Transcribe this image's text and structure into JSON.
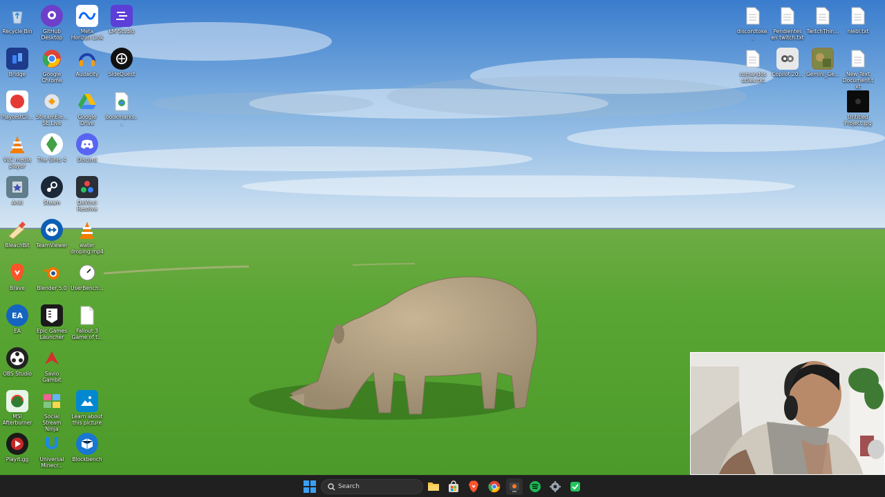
{
  "desktop": {
    "left_icons": [
      {
        "label": "Recycle Bin",
        "icon": "recycle-bin-icon",
        "color": "#c8d8e8"
      },
      {
        "label": "GitHub Desktop",
        "icon": "github-desktop-icon",
        "color": "#6e40c9"
      },
      {
        "label": "Meta Horizon Link",
        "icon": "meta-horizon-link-icon",
        "color": "#0a66ff"
      },
      {
        "label": "LM Studio",
        "icon": "lm-studio-icon",
        "color": "#5b3fd6"
      },
      {
        "label": "Bridge",
        "icon": "bridge-icon",
        "color": "#1e3a8a"
      },
      {
        "label": "Google Chrome",
        "icon": "chrome-icon",
        "color": "#34a853"
      },
      {
        "label": "Audacity",
        "icon": "audacity-icon",
        "color": "#1e40af"
      },
      {
        "label": "SideQuest",
        "icon": "sidequest-icon",
        "color": "#111111"
      },
      {
        "label": "PlaytestCli...",
        "icon": "playtestcloud-icon",
        "color": "#e53935"
      },
      {
        "label": "StreamEle... SE.Live",
        "icon": "streamelements-icon",
        "color": "#dfe6ee"
      },
      {
        "label": "Google Drive",
        "icon": "google-drive-icon",
        "color": "#fbbc04"
      },
      {
        "label": "bookmarks...",
        "icon": "bookmarks-file-icon",
        "color": "#ffffff"
      },
      {
        "label": "VLC media player",
        "icon": "vlc-icon",
        "color": "#f57c00"
      },
      {
        "label": "The Sims 4",
        "icon": "sims4-icon",
        "color": "#43a047"
      },
      {
        "label": "Discord",
        "icon": "discord-icon",
        "color": "#5865f2"
      },
      {
        "label": "Anki",
        "icon": "anki-icon",
        "color": "#607d8b"
      },
      {
        "label": "Steam",
        "icon": "steam-icon",
        "color": "#1b2838"
      },
      {
        "label": "DaVinci Resolve",
        "icon": "davinci-resolve-icon",
        "color": "#2b2f36"
      },
      {
        "label": "BleachBit",
        "icon": "bleachbit-icon",
        "color": "#f4e2b2"
      },
      {
        "label": "TeamViewer",
        "icon": "teamviewer-icon",
        "color": "#0e5fb3"
      },
      {
        "label": "water droping.mp4",
        "icon": "vlc-video-file-icon",
        "color": "#f57c00"
      },
      {
        "label": "Brave",
        "icon": "brave-icon",
        "color": "#fb542b"
      },
      {
        "label": "Blender 5.0",
        "icon": "blender-icon",
        "color": "#ea7600"
      },
      {
        "label": "UserBench...",
        "icon": "userbenchmark-icon",
        "color": "#ffffff"
      },
      {
        "label": "EA",
        "icon": "ea-icon",
        "color": "#1565c0"
      },
      {
        "label": "Epic Games Launcher",
        "icon": "epic-games-icon",
        "color": "#1a1a1a"
      },
      {
        "label": "Fallout 3 Game of t...",
        "icon": "fallout3-file-icon",
        "color": "#ffffff"
      },
      {
        "label": "OBS Studio",
        "icon": "obs-icon",
        "color": "#222222"
      },
      {
        "label": "Savio Gambit",
        "icon": "savio-gambit-icon",
        "color": "#d32f2f"
      },
      {
        "label": "MSI Afterburner",
        "icon": "msi-afterburner-icon",
        "color": "#2e7d32"
      },
      {
        "label": "Social Stream Ninja",
        "icon": "social-stream-ninja-icon",
        "color": "#f06292"
      },
      {
        "label": "Learn about this picture",
        "icon": "learn-picture-icon",
        "color": "#0288d1"
      },
      {
        "label": "Playit.gg",
        "icon": "playitgg-icon",
        "color": "#c62828"
      },
      {
        "label": "Universal Minecr...",
        "icon": "universal-minecraft-icon",
        "color": "#1e88e5"
      },
      {
        "label": "Blockbench",
        "icon": "blockbench-icon",
        "color": "#1976d2"
      }
    ],
    "right_icons": [
      {
        "label": "discordtoke...",
        "icon": "text-file-icon"
      },
      {
        "label": "Pendientes en twitch.txt",
        "icon": "text-file-icon"
      },
      {
        "label": "TwitchThin...",
        "icon": "text-file-icon"
      },
      {
        "label": "nlebl.txt",
        "icon": "text-file-icon"
      },
      {
        "label": "comandos utiles.txt",
        "icon": "text-file-icon"
      },
      {
        "label": "Copilot 20...",
        "icon": "copilot-image-icon"
      },
      {
        "label": "Gemini_Ge...",
        "icon": "gemini-image-icon"
      },
      {
        "label": "New Text Document.txt",
        "icon": "text-file-icon"
      },
      {
        "label": "Untitled Project.jpg",
        "icon": "image-file-icon"
      }
    ]
  },
  "taskbar": {
    "search_placeholder": "Search",
    "apps": [
      {
        "name": "start-button",
        "icon": "windows-logo-icon",
        "color": "#3aa0f5"
      },
      {
        "name": "file-explorer",
        "icon": "folder-icon",
        "color": "#f4c542"
      },
      {
        "name": "microsoft-store",
        "icon": "store-icon",
        "color": "#dddddd"
      },
      {
        "name": "brave",
        "icon": "brave-icon",
        "color": "#fb542b"
      },
      {
        "name": "google-chrome",
        "icon": "chrome-icon",
        "color": "#34a853"
      },
      {
        "name": "streaming-app",
        "icon": "stream-app-icon",
        "color": "#ff7a2b"
      },
      {
        "name": "spotify",
        "icon": "spotify-icon",
        "color": "#1db954"
      },
      {
        "name": "settings",
        "icon": "gear-icon",
        "color": "#9aa4b0"
      },
      {
        "name": "green-app",
        "icon": "green-app-icon",
        "color": "#22c55e"
      }
    ]
  },
  "colors": {
    "sky_top": "#3c7fcf",
    "sky_bottom": "#cfe2f3",
    "grass_top": "#63a83a",
    "grass_bottom": "#4f9b2c",
    "taskbar": "#202020"
  }
}
